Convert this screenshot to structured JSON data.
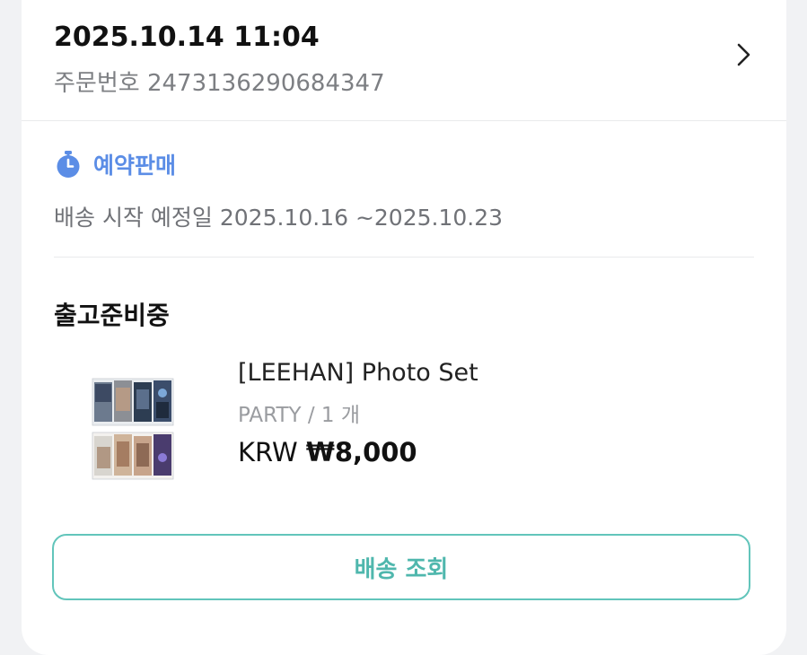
{
  "order": {
    "datetime": "2025.10.14 11:04",
    "number_label": "주문번호",
    "number": "2473136290684347"
  },
  "preorder": {
    "label": "예약판매",
    "ship_start_label": "배송 시작 예정일",
    "ship_start_range": "2025.10.16 ~2025.10.23"
  },
  "shipment": {
    "status": "출고준비중"
  },
  "product": {
    "name": "[LEEHAN] Photo Set",
    "option": "PARTY / 1 개",
    "currency": "KRW",
    "price": "₩8,000"
  },
  "actions": {
    "track_label": "배송 조회"
  },
  "colors": {
    "accent_blue": "#5b8de6",
    "accent_teal": "#62c5bb",
    "text_dark": "#111111",
    "text_gray": "#707277"
  },
  "icons": {
    "header_chevron": "chevron-right-icon",
    "preorder_icon": "stopwatch-icon"
  }
}
